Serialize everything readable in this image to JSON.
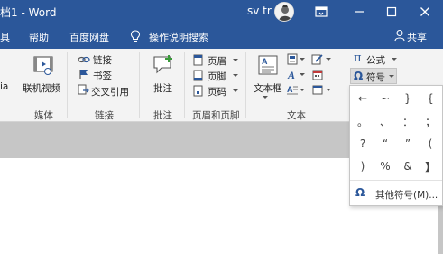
{
  "titlebar": {
    "title": "档1 - Word",
    "user": "sv tr",
    "ribbon_display_label": "功能区显示选项",
    "minimize_label": "最小化",
    "restore_label": "还原",
    "close_label": "关闭"
  },
  "menu": {
    "item_partial": "具",
    "help": "帮助",
    "baidu_pan": "百度网盘",
    "tell_me": "操作说明搜索",
    "share": "共享"
  },
  "ribbon": {
    "media": {
      "partial": "ia",
      "online_video": "联机视频",
      "group": "媒体"
    },
    "links": {
      "link": "链接",
      "bookmark": "书签",
      "cross_ref": "交叉引用",
      "group": "链接"
    },
    "comments": {
      "comment": "批注",
      "group": "批注"
    },
    "header_footer": {
      "header": "页眉",
      "footer": "页脚",
      "page_number": "页码",
      "group": "页眉和页脚"
    },
    "text": {
      "textbox": "文本框",
      "group": "文本"
    },
    "symbols": {
      "equation": "公式",
      "symbol": "符号"
    }
  },
  "dropdown": {
    "symbols": [
      "←",
      "~",
      "}",
      "{",
      "。",
      "、",
      "：",
      "；",
      "?",
      "“",
      "”",
      "(",
      ")",
      "%",
      "&",
      "】"
    ],
    "more_label": "其他符号(M)..."
  },
  "colors": {
    "brand": "#2b579a",
    "ribbon_bg": "#f3f3f3",
    "doc_bg": "#c6c6c6"
  }
}
